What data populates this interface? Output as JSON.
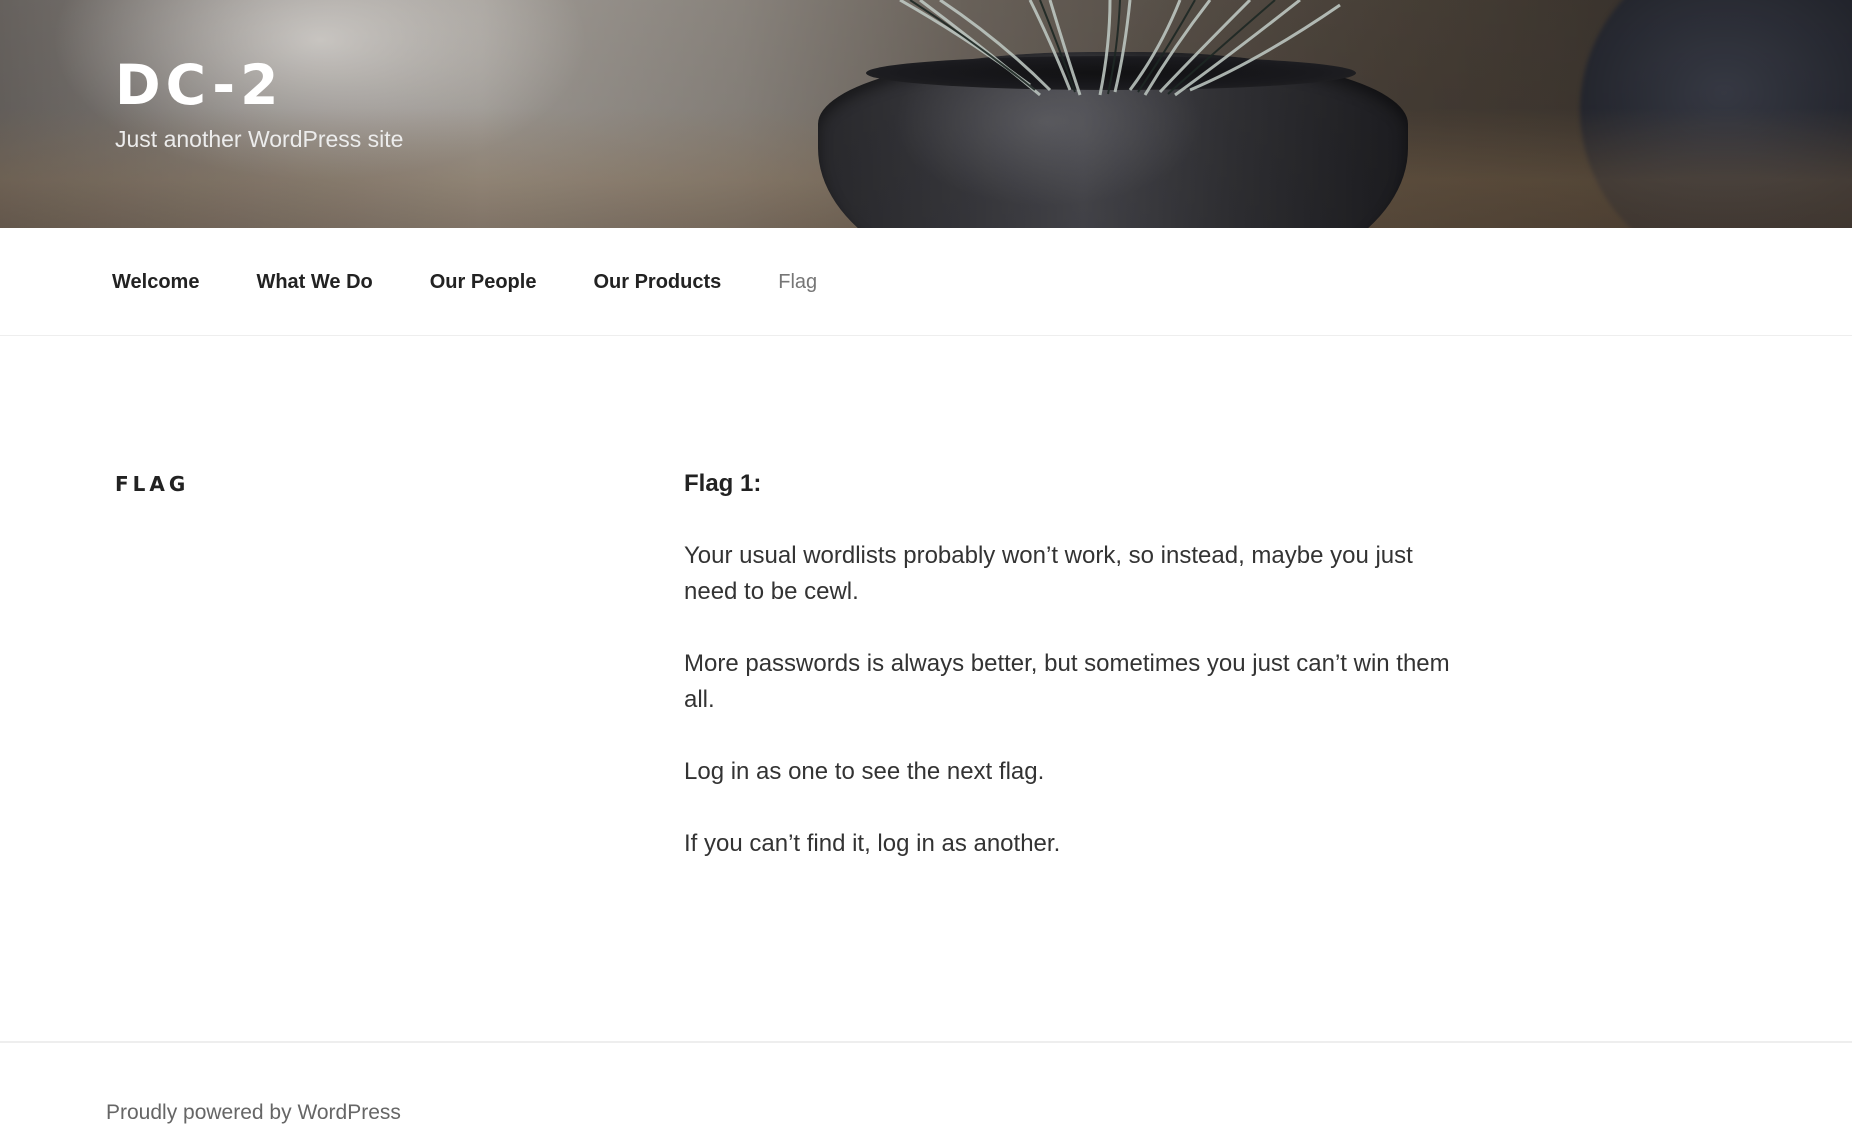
{
  "header": {
    "site_title": "DC-2",
    "site_description": "Just another WordPress site"
  },
  "nav": {
    "items": [
      {
        "label": "Welcome",
        "current": false
      },
      {
        "label": "What We Do",
        "current": false
      },
      {
        "label": "Our People",
        "current": false
      },
      {
        "label": "Our Products",
        "current": false
      },
      {
        "label": "Flag",
        "current": true
      }
    ]
  },
  "page": {
    "title": "FLAG",
    "heading": "Flag 1:",
    "paragraphs": [
      "Your usual wordlists probably won’t work, so instead, maybe you just need to be cewl.",
      "More passwords is always better, but sometimes you just can’t win them all.",
      "Log in as one to see the next flag.",
      "If you can’t find it, log in as another."
    ]
  },
  "footer": {
    "powered_by": "Proudly powered by WordPress"
  },
  "colors": {
    "text": "#222222",
    "muted": "#767676",
    "footer_link": "#666666"
  },
  "icons": {
    "header_image": "succulent-plant-in-pot-image"
  }
}
